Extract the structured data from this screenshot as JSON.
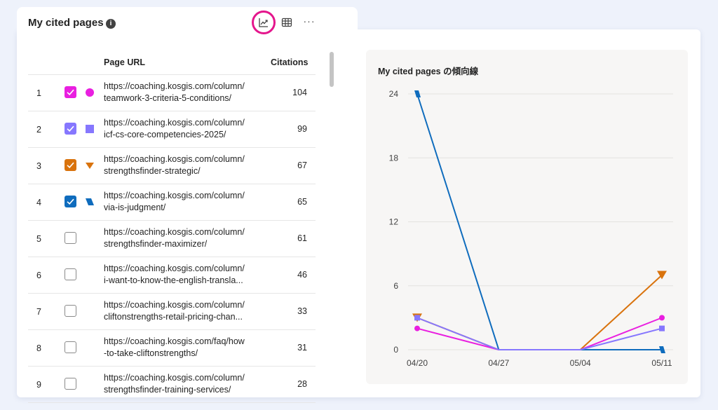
{
  "header": {
    "title": "My cited pages",
    "info_icon": "i",
    "more_label": "···"
  },
  "table": {
    "col_url": "Page URL",
    "col_citations": "Citations",
    "rows": [
      {
        "num": "1",
        "checked": true,
        "color": "#e91fe0",
        "marker": "circle",
        "url1": "https://coaching.kosgis.com/column/",
        "url2": "teamwork-3-criteria-5-conditions/",
        "citations": "104"
      },
      {
        "num": "2",
        "checked": true,
        "color": "#8677fe",
        "marker": "square",
        "url1": "https://coaching.kosgis.com/column/",
        "url2": "icf-cs-core-competencies-2025/",
        "citations": "99"
      },
      {
        "num": "3",
        "checked": true,
        "color": "#d9730d",
        "marker": "triangle-down",
        "url1": "https://coaching.kosgis.com/column/",
        "url2": "strengthsfinder-strategic/",
        "citations": "67"
      },
      {
        "num": "4",
        "checked": true,
        "color": "#0f6cbd",
        "marker": "parallelogram",
        "url1": "https://coaching.kosgis.com/column/",
        "url2": "via-is-judgment/",
        "citations": "65"
      },
      {
        "num": "5",
        "checked": false,
        "color": "",
        "marker": "",
        "url1": "https://coaching.kosgis.com/column/",
        "url2": "strengthsfinder-maximizer/",
        "citations": "61"
      },
      {
        "num": "6",
        "checked": false,
        "color": "",
        "marker": "",
        "url1": "https://coaching.kosgis.com/column/",
        "url2": "i-want-to-know-the-english-transla...",
        "citations": "46"
      },
      {
        "num": "7",
        "checked": false,
        "color": "",
        "marker": "",
        "url1": "https://coaching.kosgis.com/column/",
        "url2": "cliftonstrengths-retail-pricing-chan...",
        "citations": "33"
      },
      {
        "num": "8",
        "checked": false,
        "color": "",
        "marker": "",
        "url1": "https://coaching.kosgis.com/faq/how",
        "url2": "-to-take-cliftonstrengths/",
        "citations": "31"
      },
      {
        "num": "9",
        "checked": false,
        "color": "",
        "marker": "",
        "url1": "https://coaching.kosgis.com/column/",
        "url2": "strengthsfinder-training-services/",
        "citations": "28"
      }
    ]
  },
  "chart_data": {
    "type": "line",
    "title": "My cited pages の傾向線",
    "x": [
      "04/20",
      "04/27",
      "05/04",
      "05/11"
    ],
    "yticks": [
      "0",
      "6",
      "12",
      "18",
      "24"
    ],
    "ylim": [
      0,
      24
    ],
    "grid": true,
    "series": [
      {
        "color": "#0f6cbd",
        "marker": "parallelogram",
        "values": [
          24,
          0,
          0,
          0
        ]
      },
      {
        "color": "#d9730d",
        "marker": "triangle-down",
        "values": [
          3,
          0,
          0,
          7
        ]
      },
      {
        "color": "#e91fe0",
        "marker": "circle",
        "values": [
          2,
          0,
          0,
          3
        ]
      },
      {
        "color": "#8677fe",
        "marker": "square",
        "values": [
          3,
          0,
          0,
          2
        ]
      }
    ]
  }
}
